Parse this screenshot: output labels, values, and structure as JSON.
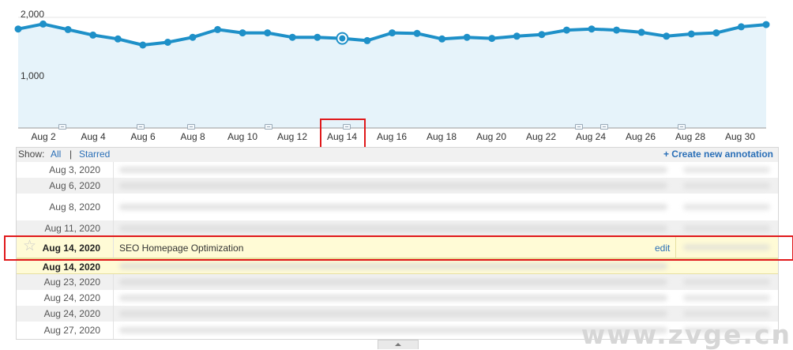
{
  "chart": {
    "y_ticks": [
      "2,000",
      "1,000"
    ],
    "x_labels": [
      "Aug 2",
      "Aug 4",
      "Aug 6",
      "Aug 8",
      "Aug 10",
      "Aug 12",
      "Aug 14",
      "Aug 16",
      "Aug 18",
      "Aug 20",
      "Aug 22",
      "Aug 24",
      "Aug 26",
      "Aug 28",
      "Aug 30"
    ],
    "line_color": "#1e90c8",
    "fill_color": "#e6f3fa",
    "highlight_color": "#e0191b"
  },
  "chart_data": {
    "type": "line",
    "x": [
      "Aug 1",
      "Aug 2",
      "Aug 3",
      "Aug 4",
      "Aug 5",
      "Aug 6",
      "Aug 7",
      "Aug 8",
      "Aug 9",
      "Aug 10",
      "Aug 11",
      "Aug 12",
      "Aug 13",
      "Aug 14",
      "Aug 15",
      "Aug 16",
      "Aug 17",
      "Aug 18",
      "Aug 19",
      "Aug 20",
      "Aug 21",
      "Aug 22",
      "Aug 23",
      "Aug 24",
      "Aug 25",
      "Aug 26",
      "Aug 27",
      "Aug 28",
      "Aug 29",
      "Aug 30",
      "Aug 31"
    ],
    "values": [
      1790,
      1880,
      1780,
      1680,
      1610,
      1500,
      1550,
      1640,
      1780,
      1720,
      1720,
      1640,
      1640,
      1620,
      1580,
      1720,
      1710,
      1610,
      1640,
      1620,
      1660,
      1690,
      1770,
      1790,
      1770,
      1730,
      1660,
      1700,
      1720,
      1830,
      1870
    ],
    "yticks": [
      1000,
      2000
    ],
    "ylim": [
      0,
      2200
    ],
    "highlighted_point": "Aug 14",
    "annotation_dates": [
      "Aug 3",
      "Aug 6",
      "Aug 8",
      "Aug 11",
      "Aug 14",
      "Aug 23",
      "Aug 24",
      "Aug 27"
    ],
    "grid": true
  },
  "annotations": {
    "show_label": "Show:",
    "filter_all": "All",
    "filter_sep": "|",
    "filter_starred": "Starred",
    "create_link": "+ Create new annotation",
    "rows": [
      {
        "date": "Aug 3, 2020"
      },
      {
        "date": "Aug 6, 2020"
      },
      {
        "date": "Aug 8, 2020"
      },
      {
        "date": "Aug 11, 2020"
      },
      {
        "date": "Aug 14, 2020",
        "text": "SEO Homepage Optimization",
        "edit": "edit",
        "highlighted": true
      },
      {
        "date": "Aug 14, 2020"
      },
      {
        "date": "Aug 23, 2020"
      },
      {
        "date": "Aug 24, 2020"
      },
      {
        "date": "Aug 24, 2020"
      },
      {
        "date": "Aug 27, 2020"
      }
    ]
  },
  "watermark": "www.zvge.cn"
}
